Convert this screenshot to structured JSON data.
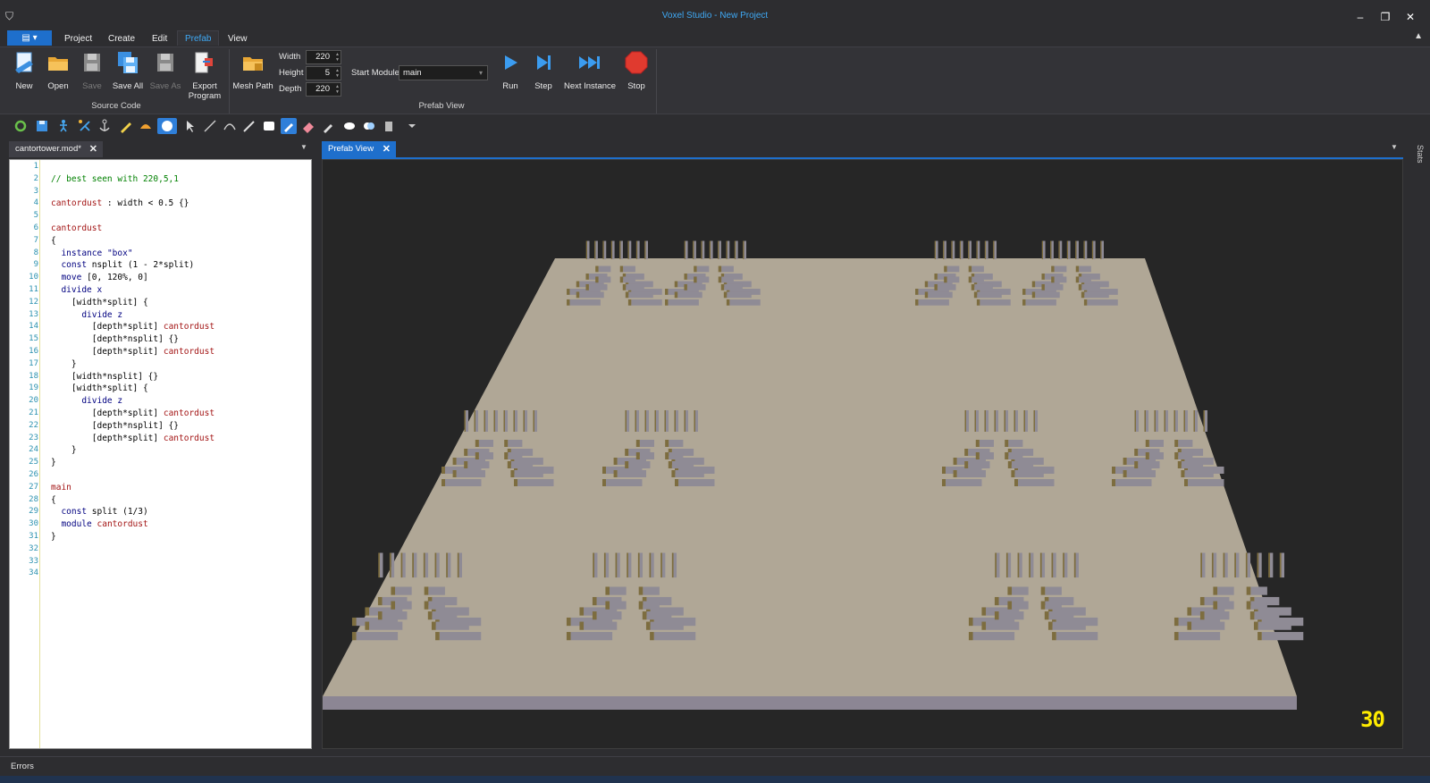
{
  "window": {
    "title": "Voxel Studio - New Project",
    "controls": [
      "minimize",
      "restore",
      "close"
    ]
  },
  "menu": {
    "items": [
      "Project",
      "Create",
      "Edit",
      "Prefab",
      "View"
    ],
    "active": "Prefab"
  },
  "ribbon": {
    "source_code": {
      "group_label": "Source Code",
      "buttons": {
        "new": "New",
        "open": "Open",
        "save": "Save",
        "save_all": "Save All",
        "save_as": "Save As",
        "export_line1": "Export",
        "export_line2": "Program"
      }
    },
    "prefab_view": {
      "group_label": "Prefab View",
      "mesh_path": "Mesh Path",
      "width_label": "Width",
      "width_value": "220",
      "height_label": "Height",
      "height_value": "5",
      "depth_label": "Depth",
      "depth_value": "220",
      "start_module_label": "Start Module",
      "start_module_value": "main",
      "run": "Run",
      "step": "Step",
      "next_instance": "Next Instance",
      "stop": "Stop"
    }
  },
  "editor": {
    "tab_label": "cantortower.mod*",
    "lines": [
      "",
      "// best seen with 220,5,1",
      "",
      "cantordust : width < 0.5 {}",
      "",
      "cantordust",
      "{",
      "  instance \"box\"",
      "  const nsplit (1 - 2*split)",
      "  move [0, 120%, 0]",
      "  divide x",
      "    [width*split] {",
      "      divide z",
      "        [depth*split] cantordust",
      "        [depth*nsplit] {}",
      "        [depth*split] cantordust",
      "    }",
      "    [width*nsplit] {}",
      "    [width*split] {",
      "      divide z",
      "        [depth*split] cantordust",
      "        [depth*nsplit] {}",
      "        [depth*split] cantordust",
      "    }",
      "}",
      "",
      "main",
      "{",
      "  const split (1/3)",
      "  module cantordust",
      "}",
      "",
      "",
      ""
    ]
  },
  "viewport": {
    "tab_label": "Prefab View",
    "fps": "30"
  },
  "side_panel": {
    "stats_label": "Stats"
  },
  "bottom": {
    "errors_label": "Errors"
  },
  "colors": {
    "accent": "#1e6fcc",
    "title_text": "#3fa9f5",
    "stop_red": "#e03a2f",
    "fps_yellow": "#ffec00",
    "floor": "#b0a796",
    "box_top": "#8f8b95",
    "box_side": "#7d6d3f"
  }
}
